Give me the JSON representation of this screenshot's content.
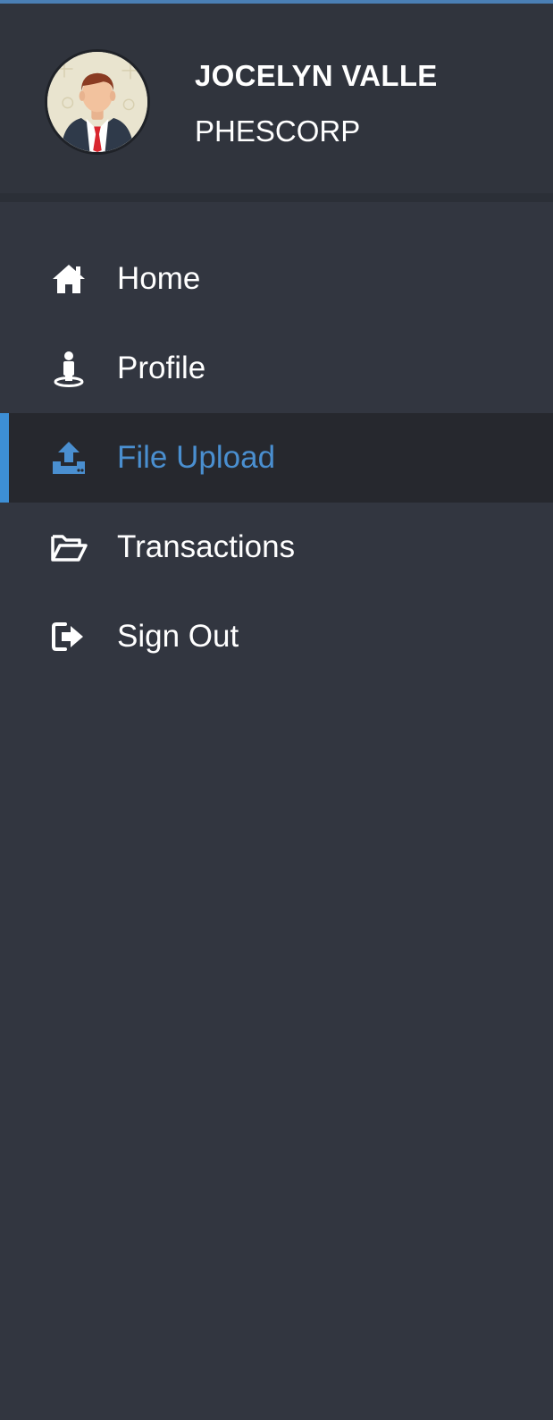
{
  "user": {
    "name": "JOCELYN VALLE",
    "company": "PHESCORP",
    "avatar_icon": "businessman-avatar"
  },
  "menu": {
    "items": [
      {
        "label": "Home",
        "icon": "home-icon",
        "active": false
      },
      {
        "label": "Profile",
        "icon": "user-icon",
        "active": false
      },
      {
        "label": "File Upload",
        "icon": "upload-icon",
        "active": true
      },
      {
        "label": "Transactions",
        "icon": "folder-open-icon",
        "active": false
      },
      {
        "label": "Sign Out",
        "icon": "sign-out-icon",
        "active": false
      }
    ]
  },
  "colors": {
    "background": "#323640",
    "active_background": "#26282e",
    "active_accent": "#3d8fd6",
    "active_text": "#4a8fd0",
    "text": "#ffffff"
  }
}
